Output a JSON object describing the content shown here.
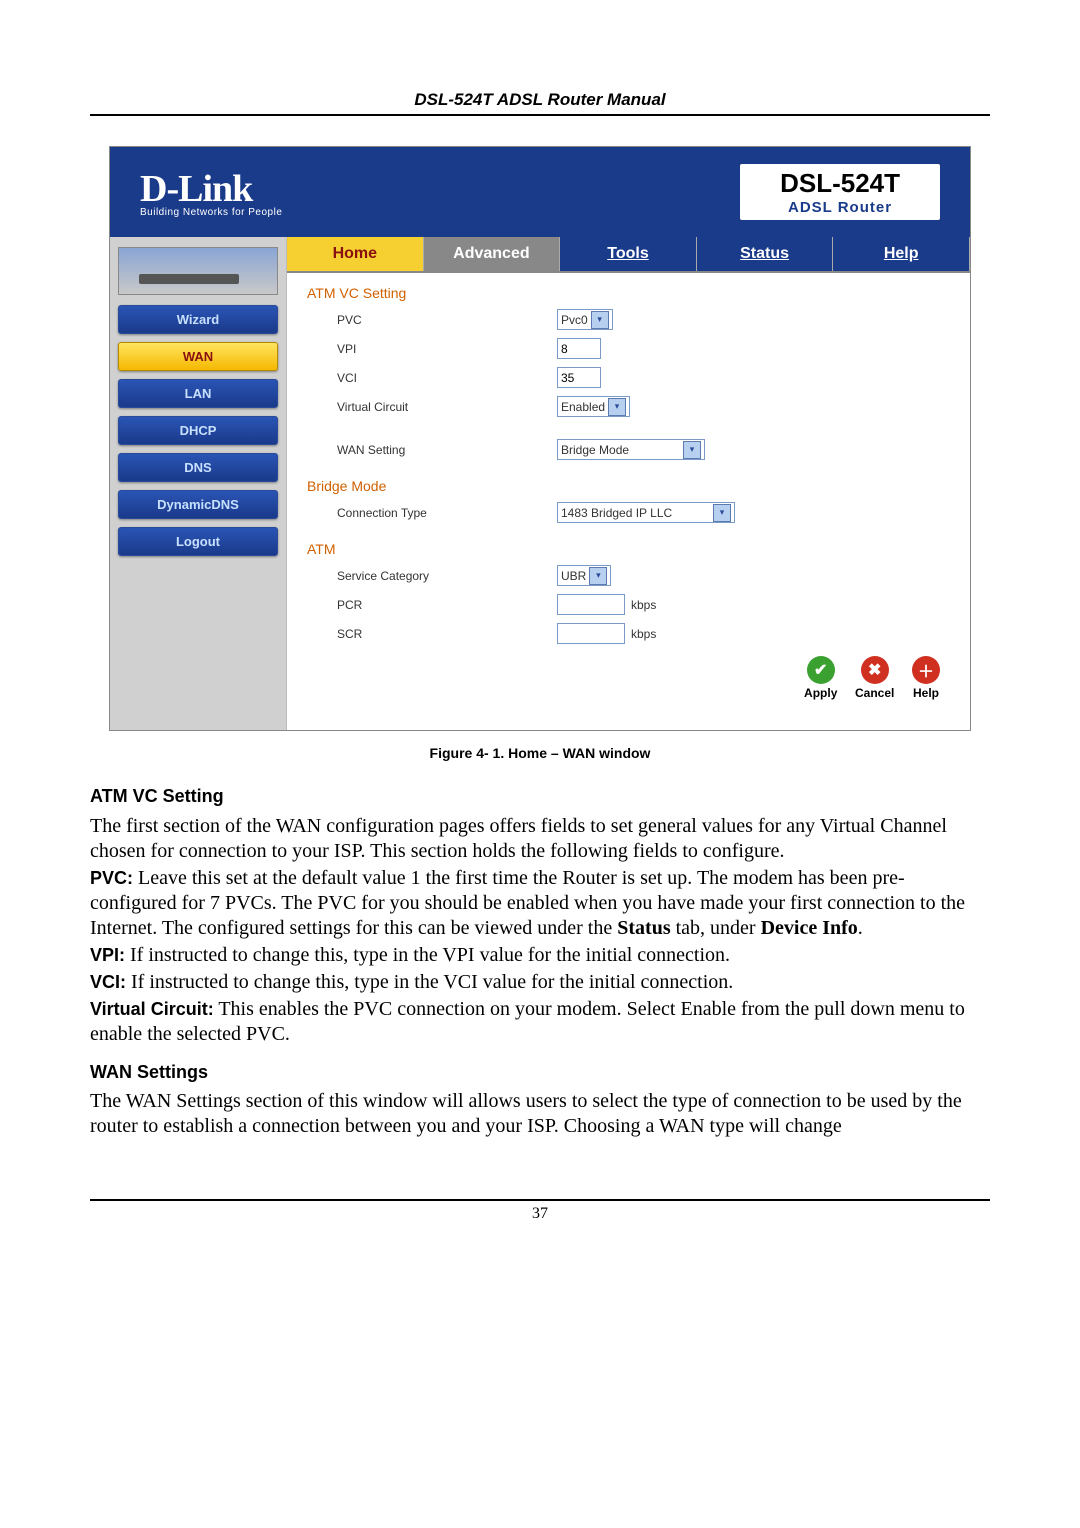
{
  "doc_header": "DSL-524T ADSL Router Manual",
  "brand": {
    "logo": "D-Link",
    "tag": "Building Networks for People",
    "model": "DSL-524T",
    "sub": "ADSL Router"
  },
  "sidebar": {
    "items": [
      {
        "label": "Wizard"
      },
      {
        "label": "WAN"
      },
      {
        "label": "LAN"
      },
      {
        "label": "DHCP"
      },
      {
        "label": "DNS"
      },
      {
        "label": "DynamicDNS"
      },
      {
        "label": "Logout"
      }
    ]
  },
  "tabs": {
    "home": "Home",
    "advanced": "Advanced",
    "tools": "Tools",
    "status": "Status",
    "help": "Help"
  },
  "sections": {
    "atm_vc": {
      "title": "ATM VC Setting",
      "pvc_label": "PVC",
      "pvc_value": "Pvc0",
      "vpi_label": "VPI",
      "vpi_value": "8",
      "vci_label": "VCI",
      "vci_value": "35",
      "vc_label": "Virtual Circuit",
      "vc_value": "Enabled",
      "wan_label": "WAN Setting",
      "wan_value": "Bridge Mode"
    },
    "bridge": {
      "title": "Bridge Mode",
      "ct_label": "Connection Type",
      "ct_value": "1483 Bridged IP LLC"
    },
    "atm": {
      "title": "ATM",
      "sc_label": "Service Category",
      "sc_value": "UBR",
      "pcr_label": "PCR",
      "pcr_unit": "kbps",
      "scr_label": "SCR",
      "scr_unit": "kbps"
    }
  },
  "actions": {
    "apply": "Apply",
    "cancel": "Cancel",
    "help": "Help"
  },
  "figure_caption": "Figure 4- 1. Home – WAN window",
  "text": {
    "h1": "ATM VC Setting",
    "p1": "The first section of the WAN configuration pages offers fields to set general values for any Virtual Channel chosen for connection to your ISP. This section holds the following fields to configure.",
    "pvc_b": "PVC:",
    "pvc_t": " Leave this set at the default value 1 the first time the Router is set up. The modem has been pre-configured for 7 PVCs. The PVC for you should be enabled when you have made your first connection to the Internet. The configured settings for this can be viewed under the ",
    "status_b": "Status",
    "pvc_t2": " tab, under ",
    "devinfo_b": "Device Info",
    "dot": ".",
    "vpi_b": "VPI:",
    "vpi_t": " If instructed to change this, type in the VPI value for the initial connection.",
    "vci_b": "VCI:",
    "vci_t": " If instructed to change this, type in the VCI value for the initial connection.",
    "vc_b": "Virtual Circuit:",
    "vc_t": " This enables the PVC connection on your modem. Select Enable from the pull down menu to enable the selected PVC.",
    "h2": "WAN Settings",
    "p2": "The WAN Settings section of this window will allows users to select the type of connection to be used by the router to establish a connection between you and your ISP. Choosing a WAN type will change"
  },
  "page_number": "37"
}
